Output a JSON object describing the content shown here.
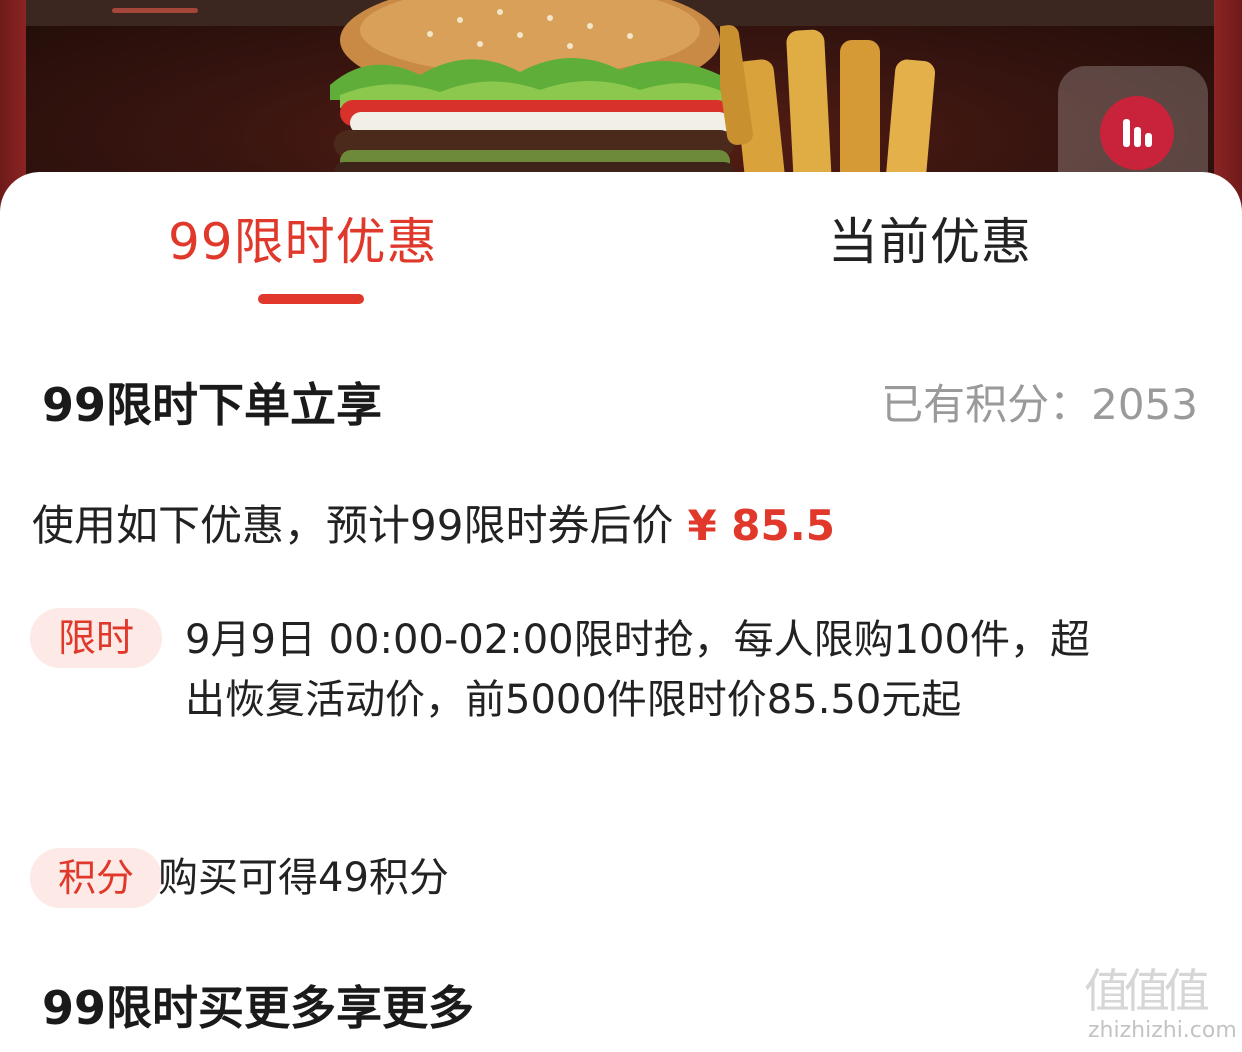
{
  "tabs": [
    {
      "label": "99限时优惠",
      "active": true
    },
    {
      "label": "当前优惠",
      "active": false
    }
  ],
  "section1": {
    "title": "99限时下单立享",
    "points_label": "已有积分：",
    "points_value": "2053",
    "summary_text": "使用如下优惠，预计99限时券后价",
    "price": "¥ 85.5"
  },
  "promos": [
    {
      "tag": "限时",
      "text": "9月9日 00:00-02:00限时抢，每人限购100件，超出恢复活动价，前5000件限时价85.50元起"
    },
    {
      "tag": "积分",
      "text": "购买可得49积分"
    }
  ],
  "section2": {
    "title": "99限时买更多享更多"
  },
  "watermark": {
    "glyphs": "值值值",
    "url": "zhizhizhi.com"
  },
  "colors": {
    "accent": "#e0382b",
    "tag_bg": "#fde9e6",
    "muted": "#9a9a9a"
  }
}
